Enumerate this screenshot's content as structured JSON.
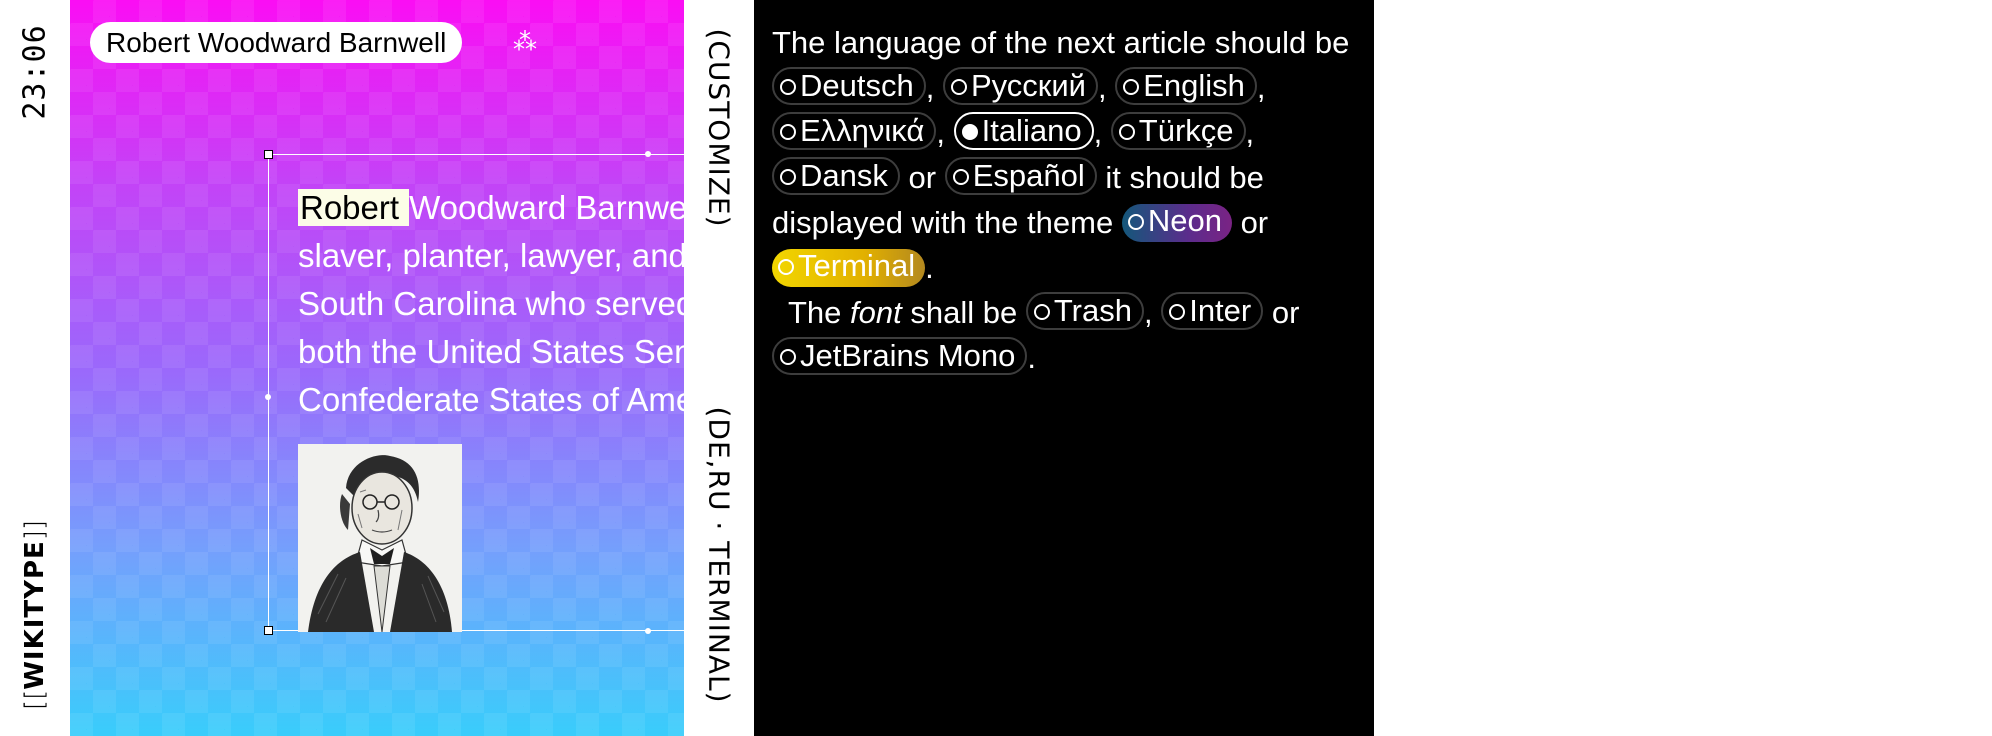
{
  "left_rail": {
    "clock": "23:06",
    "brand_open": "[[",
    "brand": "WIKITYPE",
    "brand_close": "]]"
  },
  "article": {
    "title": "Robert Woodward Barnwell",
    "title_glyph": "⁂",
    "highlight_word": "Robert",
    "lines": [
      "Woodward Barnwell was an American",
      "slaver, planter, lawyer, and politician from",
      "South Carolina who served as a member of",
      "both the United States Senate and the",
      "Confederate States of America"
    ],
    "portrait_icon": "portrait-engraving-image"
  },
  "middle_rail": {
    "customize": "(CUSTOMIZE)",
    "current_mode": "(DE,RU · TERMINAL)"
  },
  "settings": {
    "intro": "The language of the next article should be",
    "languages": [
      "Deutsch",
      "Русский",
      "English",
      "Ελληνικά",
      "Italiano",
      "Türkçe",
      "Dansk",
      "Español"
    ],
    "selected_language": "Italiano",
    "or_1": "or",
    "theme_prefix": "it should be displayed with the theme",
    "themes": [
      "Neon",
      "Terminal"
    ],
    "or_2": "or",
    "font_prefix_1": "The",
    "font_word": "font",
    "font_prefix_2": "shall be",
    "fonts": [
      "Trash",
      "Inter",
      "JetBrains Mono"
    ],
    "or_3": "or",
    "period": "."
  },
  "colors": {
    "gradient_top": "#fb0df4",
    "gradient_bottom": "#39cdfb",
    "panel_bg": "#000000",
    "neon": "#5b2c8c",
    "terminal": "#e2b100"
  }
}
